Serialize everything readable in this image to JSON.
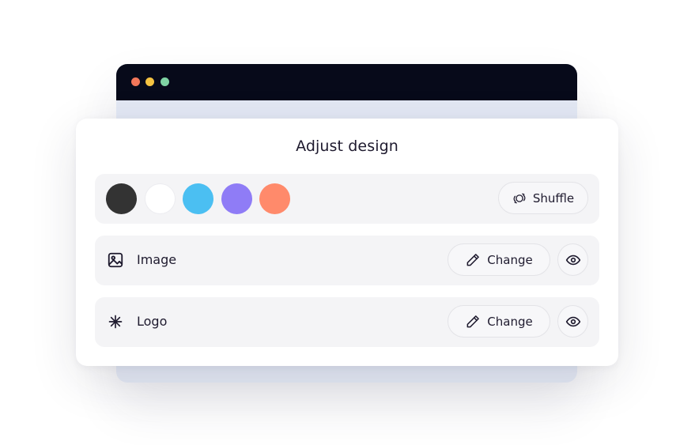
{
  "window": {
    "traffic_lights": [
      "#f2775a",
      "#f5c341",
      "#7fd3a3"
    ]
  },
  "panel": {
    "title": "Adjust design",
    "colors": {
      "swatches": [
        "#333333",
        "#ffffff",
        "#4bbff2",
        "#8f7cf6",
        "#ff8a6b"
      ],
      "shuffle_label": "Shuffle",
      "shuffle_icon": "shuffle-icon"
    },
    "image": {
      "icon": "image-icon",
      "label": "Image",
      "change_label": "Change",
      "change_icon": "pencil-icon",
      "visibility_icon": "eye-icon"
    },
    "logo": {
      "icon": "asterisk-icon",
      "label": "Logo",
      "change_label": "Change",
      "change_icon": "pencil-icon",
      "visibility_icon": "eye-icon"
    }
  }
}
